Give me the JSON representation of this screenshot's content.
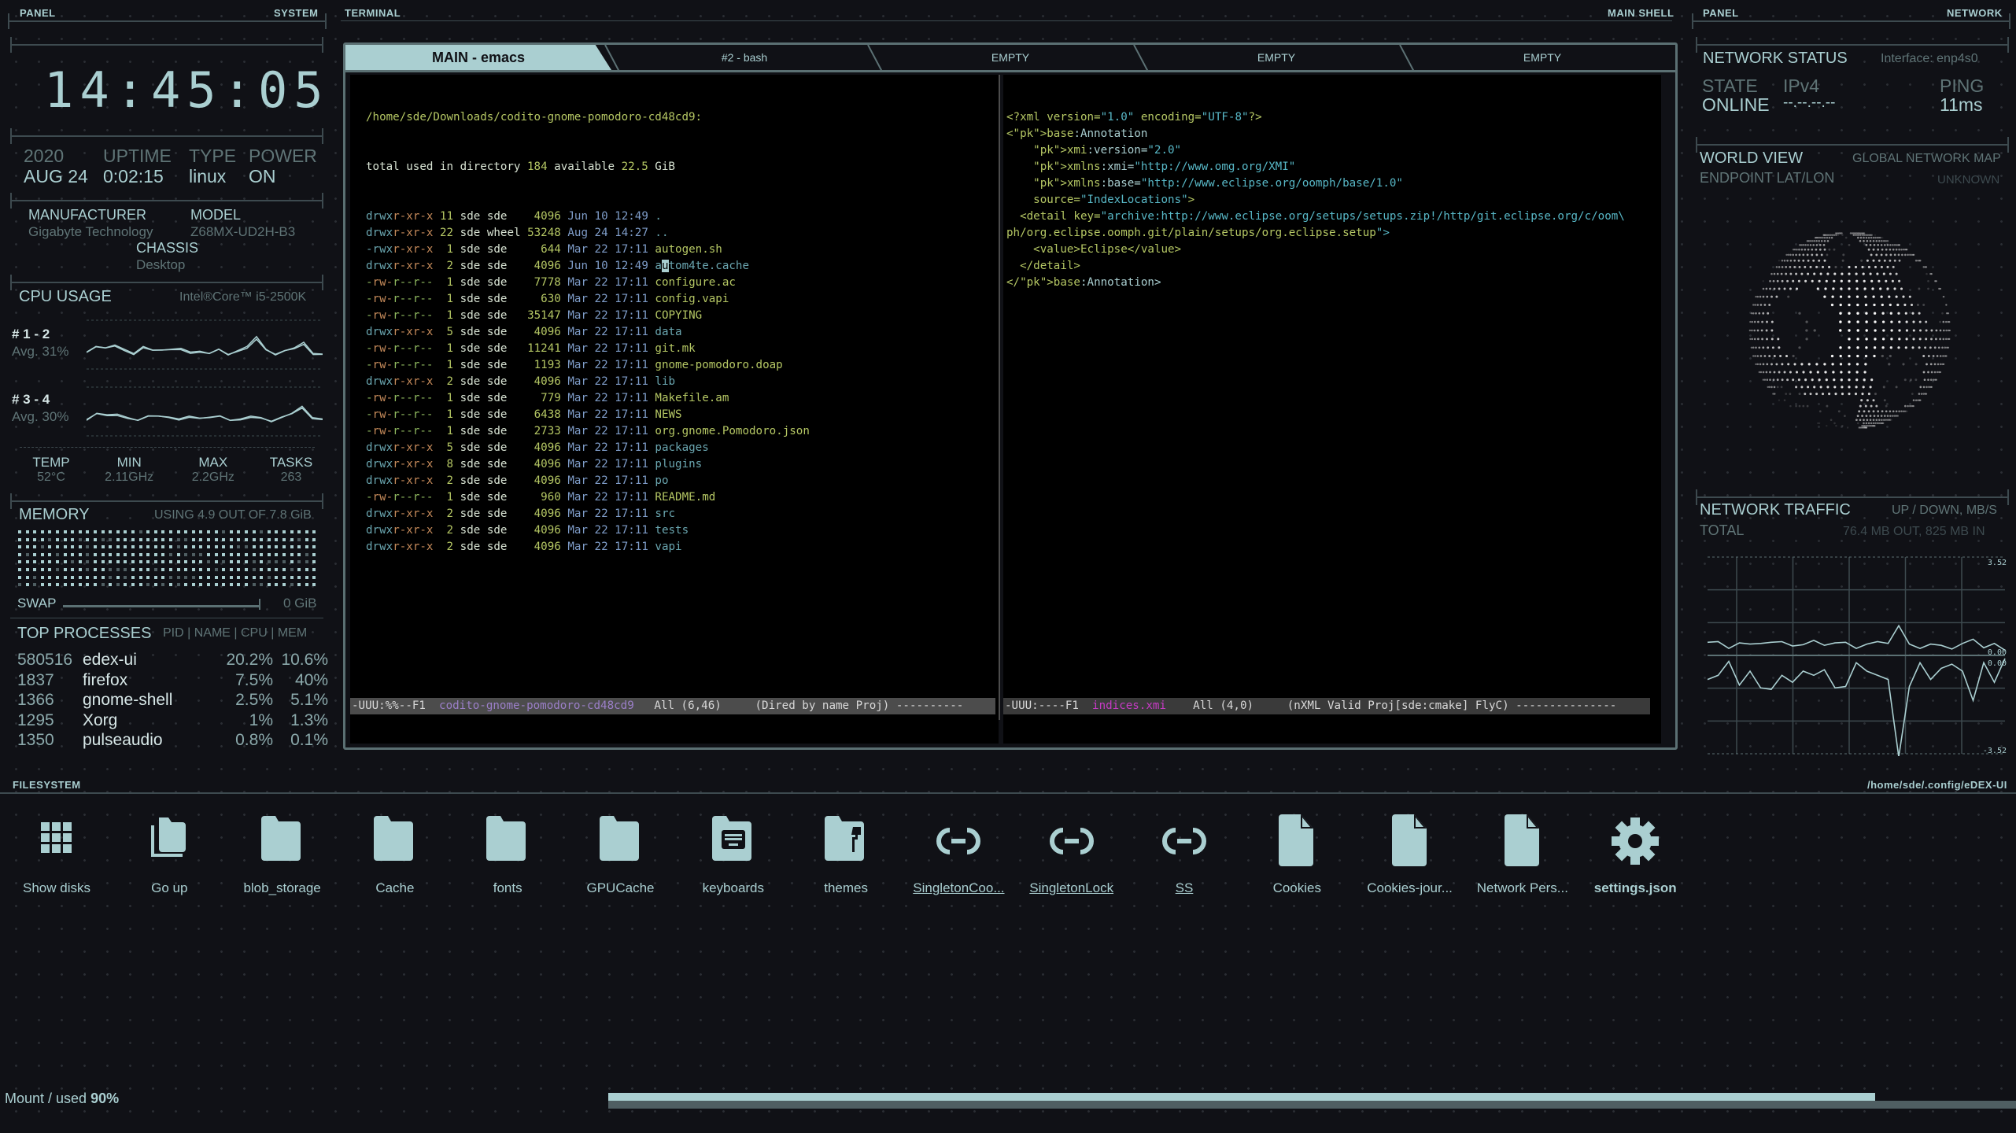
{
  "left_panel": {
    "header_left": "PANEL",
    "header_right": "SYSTEM",
    "clock": "14:45:05",
    "clock_parts": [
      "14",
      "45",
      "05"
    ],
    "date_year": "2020",
    "date_day": "AUG 24",
    "uptime_label": "UPTIME",
    "uptime_value": "0:02:15",
    "type_label": "TYPE",
    "type_value": "linux",
    "power_label": "POWER",
    "power_value": "ON",
    "manufacturer_label": "MANUFACTURER",
    "manufacturer_value": "Gigabyte Technology",
    "model_label": "MODEL",
    "model_value": "Z68MX-UD2H-B3",
    "chassis_label": "CHASSIS",
    "chassis_value": "Desktop",
    "cpu": {
      "title": "CPU USAGE",
      "model": "Intel®Core™ i5-2500K",
      "groups": [
        {
          "label": "# 1 - 2",
          "avg": "Avg. 31%"
        },
        {
          "label": "# 3 - 4",
          "avg": "Avg. 30%"
        }
      ],
      "stats": [
        {
          "label": "TEMP",
          "value": "52°C"
        },
        {
          "label": "MIN",
          "value": "2.11GHz"
        },
        {
          "label": "MAX",
          "value": "2.2GHz"
        },
        {
          "label": "TASKS",
          "value": "263"
        }
      ]
    },
    "memory": {
      "title": "MEMORY",
      "usage": "USING 4.9 OUT OF 7.8 GiB",
      "used_fraction": 0.63,
      "swap_label": "SWAP",
      "swap_value": "0 GiB"
    },
    "processes": {
      "title": "TOP PROCESSES",
      "columns": "PID | NAME | CPU | MEM",
      "rows": [
        {
          "pid": "580516",
          "name": "edex-ui",
          "cpu": "20.2%",
          "mem": "10.6%"
        },
        {
          "pid": "1837",
          "name": "firefox",
          "cpu": "7.5%",
          "mem": "40%"
        },
        {
          "pid": "1366",
          "name": "gnome-shell",
          "cpu": "2.5%",
          "mem": "5.1%"
        },
        {
          "pid": "1295",
          "name": "Xorg",
          "cpu": "1%",
          "mem": "1.3%"
        },
        {
          "pid": "1350",
          "name": "pulseaudio",
          "cpu": "0.8%",
          "mem": "0.1%"
        }
      ]
    }
  },
  "terminal": {
    "header_left": "TERMINAL",
    "header_right": "MAIN SHELL",
    "tabs": [
      {
        "label": "MAIN - emacs",
        "active": true
      },
      {
        "label": "#2 - bash",
        "active": false
      },
      {
        "label": "EMPTY",
        "active": false
      },
      {
        "label": "EMPTY",
        "active": false
      },
      {
        "label": "EMPTY",
        "active": false
      }
    ],
    "dired": {
      "path": "/home/sde/Downloads/codito-gnome-pomodoro-cd48cd9:",
      "summary_pre": "total used in directory ",
      "summary_used": "184",
      "summary_mid": " available ",
      "summary_avail": "22.5",
      "summary_post": " GiB",
      "entries": [
        {
          "perm": "drwxr-xr-x",
          "links": "11",
          "user": "sde",
          "group": "sde  ",
          "size": " 4096",
          "date": "Jun 10 12:49",
          "name": ".",
          "dir": true
        },
        {
          "perm": "drwxr-xr-x",
          "links": "22",
          "user": "sde",
          "group": "wheel",
          "size": "53248",
          "date": "Aug 24 14:27",
          "name": "..",
          "dir": true
        },
        {
          "perm": "-rwxr-xr-x",
          "links": " 1",
          "user": "sde",
          "group": "sde  ",
          "size": "  644",
          "date": "Mar 22 17:11",
          "name": "autogen.sh",
          "dir": false
        },
        {
          "perm": "drwxr-xr-x",
          "links": " 2",
          "user": "sde",
          "group": "sde  ",
          "size": " 4096",
          "date": "Jun 10 12:49",
          "name": "autom4te.cache",
          "dir": true
        },
        {
          "perm": "-rw-r--r--",
          "links": " 1",
          "user": "sde",
          "group": "sde  ",
          "size": " 7778",
          "date": "Mar 22 17:11",
          "name": "configure.ac",
          "dir": false
        },
        {
          "perm": "-rw-r--r--",
          "links": " 1",
          "user": "sde",
          "group": "sde  ",
          "size": "  630",
          "date": "Mar 22 17:11",
          "name": "config.vapi",
          "dir": false
        },
        {
          "perm": "-rw-r--r--",
          "links": " 1",
          "user": "sde",
          "group": "sde  ",
          "size": "35147",
          "date": "Mar 22 17:11",
          "name": "COPYING",
          "dir": false
        },
        {
          "perm": "drwxr-xr-x",
          "links": " 5",
          "user": "sde",
          "group": "sde  ",
          "size": " 4096",
          "date": "Mar 22 17:11",
          "name": "data",
          "dir": true
        },
        {
          "perm": "-rw-r--r--",
          "links": " 1",
          "user": "sde",
          "group": "sde  ",
          "size": "11241",
          "date": "Mar 22 17:11",
          "name": "git.mk",
          "dir": false
        },
        {
          "perm": "-rw-r--r--",
          "links": " 1",
          "user": "sde",
          "group": "sde  ",
          "size": " 1193",
          "date": "Mar 22 17:11",
          "name": "gnome-pomodoro.doap",
          "dir": false
        },
        {
          "perm": "drwxr-xr-x",
          "links": " 2",
          "user": "sde",
          "group": "sde  ",
          "size": " 4096",
          "date": "Mar 22 17:11",
          "name": "lib",
          "dir": true
        },
        {
          "perm": "-rw-r--r--",
          "links": " 1",
          "user": "sde",
          "group": "sde  ",
          "size": "  779",
          "date": "Mar 22 17:11",
          "name": "Makefile.am",
          "dir": false
        },
        {
          "perm": "-rw-r--r--",
          "links": " 1",
          "user": "sde",
          "group": "sde  ",
          "size": " 6438",
          "date": "Mar 22 17:11",
          "name": "NEWS",
          "dir": false
        },
        {
          "perm": "-rw-r--r--",
          "links": " 1",
          "user": "sde",
          "group": "sde  ",
          "size": " 2733",
          "date": "Mar 22 17:11",
          "name": "org.gnome.Pomodoro.json",
          "dir": false
        },
        {
          "perm": "drwxr-xr-x",
          "links": " 5",
          "user": "sde",
          "group": "sde  ",
          "size": " 4096",
          "date": "Mar 22 17:11",
          "name": "packages",
          "dir": true
        },
        {
          "perm": "drwxr-xr-x",
          "links": " 8",
          "user": "sde",
          "group": "sde  ",
          "size": " 4096",
          "date": "Mar 22 17:11",
          "name": "plugins",
          "dir": true
        },
        {
          "perm": "drwxr-xr-x",
          "links": " 2",
          "user": "sde",
          "group": "sde  ",
          "size": " 4096",
          "date": "Mar 22 17:11",
          "name": "po",
          "dir": true
        },
        {
          "perm": "-rw-r--r--",
          "links": " 1",
          "user": "sde",
          "group": "sde  ",
          "size": "  960",
          "date": "Mar 22 17:11",
          "name": "README.md",
          "dir": false
        },
        {
          "perm": "drwxr-xr-x",
          "links": " 2",
          "user": "sde",
          "group": "sde  ",
          "size": " 4096",
          "date": "Mar 22 17:11",
          "name": "src",
          "dir": true
        },
        {
          "perm": "drwxr-xr-x",
          "links": " 2",
          "user": "sde",
          "group": "sde  ",
          "size": " 4096",
          "date": "Mar 22 17:11",
          "name": "tests",
          "dir": true
        },
        {
          "perm": "drwxr-xr-x",
          "links": " 2",
          "user": "sde",
          "group": "sde  ",
          "size": " 4096",
          "date": "Mar 22 17:11",
          "name": "vapi",
          "dir": true
        }
      ],
      "modeline": {
        "status": "-UUU:%%--F1  ",
        "buffer": "codito-gnome-pomodoro-cd48cd9",
        "position": "   All (6,46)     ",
        "mode": "(Dired by name Proj) ----------"
      }
    },
    "xml": {
      "lines": [
        "<?xml version=\"1.0\" encoding=\"UTF-8\"?>",
        "<base:Annotation",
        "    xmi:version=\"2.0\"",
        "    xmlns:xmi=\"http://www.omg.org/XMI\"",
        "    xmlns:base=\"http://www.eclipse.org/oomph/base/1.0\"",
        "    source=\"IndexLocations\">",
        "  <detail key=\"archive:http://www.eclipse.org/setups/setups.zip!/http/git.eclipse.org/c/oom\\",
        "ph/org.eclipse.oomph.git/plain/setups/org.eclipse.setup\">",
        "    <value>Eclipse</value>",
        "  </detail>",
        "</base:Annotation>"
      ],
      "modeline": {
        "status": "-UUU:----F1  ",
        "buffer": "indices.xmi",
        "position": "    All (4,0)     ",
        "mode": "(nXML Valid Proj[sde:cmake] FlyC) ---------------"
      }
    }
  },
  "right_panel": {
    "header_left": "PANEL",
    "header_right": "NETWORK",
    "status": {
      "title": "NETWORK STATUS",
      "interface": "Interface: enp4s0",
      "state_label": "STATE",
      "state_value": "ONLINE",
      "ipv4_label": "IPv4",
      "ipv4_value": "--.--.--.--",
      "ping_label": "PING",
      "ping_value": "11ms"
    },
    "world": {
      "title": "WORLD VIEW",
      "subtitle": "GLOBAL NETWORK MAP",
      "endpoint_label": "ENDPOINT LAT/LON",
      "endpoint_value": "UNKNOWN"
    },
    "traffic": {
      "title": "NETWORK TRAFFIC",
      "units": "UP / DOWN, MB/S",
      "total_label": "TOTAL",
      "total_value": "76.4 MB OUT, 825 MB IN",
      "max_label": "3.52",
      "zero_up_label": "0.00",
      "zero_down_label": "0.00",
      "min_label": "-3.52"
    }
  },
  "chart_data": {
    "type": "line",
    "title": "NETWORK TRAFFIC",
    "ylabel": "MB/S",
    "ylim": [
      -3.52,
      3.52
    ],
    "series": [
      {
        "name": "up",
        "values": [
          0.15,
          0.16,
          0.05,
          0.14,
          0.12,
          0.13,
          0.15,
          0.16,
          0.09,
          0.11,
          0.18,
          0.1,
          0.14,
          0.15,
          0.05,
          0.12,
          0.16,
          0.13,
          0.42,
          0.12,
          0.05,
          0.12,
          0.1,
          0.04,
          0.13,
          0.2,
          0.06,
          0.13,
          0.02
        ]
      },
      {
        "name": "down",
        "values": [
          -0.75,
          -0.6,
          -0.1,
          -0.95,
          -0.45,
          -1.05,
          -1.1,
          -0.6,
          -0.85,
          -0.45,
          -0.6,
          -0.4,
          -1.05,
          -1.0,
          -0.15,
          -0.45,
          -0.6,
          -0.75,
          -3.52,
          -1.0,
          -0.15,
          -0.75,
          -0.35,
          -0.2,
          -0.45,
          -1.5,
          -0.15,
          -0.85,
          0.0
        ]
      }
    ]
  },
  "cpu_charts": {
    "core12": [
      0.35,
      0.55,
      0.5,
      0.6,
      0.45,
      0.3,
      0.55,
      0.42,
      0.42,
      0.45,
      0.48,
      0.35,
      0.38,
      0.3,
      0.45,
      0.25,
      0.4,
      0.55,
      0.9,
      0.45,
      0.25,
      0.4,
      0.5,
      0.7,
      0.3,
      0.28
    ],
    "core34": [
      0.3,
      0.55,
      0.5,
      0.52,
      0.4,
      0.3,
      0.45,
      0.45,
      0.42,
      0.35,
      0.45,
      0.38,
      0.4,
      0.45,
      0.3,
      0.35,
      0.45,
      0.4,
      0.25,
      0.4,
      0.55,
      0.8,
      0.4,
      0.35
    ]
  },
  "filesystem": {
    "header_left": "FILESYSTEM",
    "header_right": "/home/sde/.config/eDEX-UI",
    "items": [
      {
        "label": "Show disks",
        "icon": "grid-icon",
        "style": "normal"
      },
      {
        "label": "Go up",
        "icon": "folder-up-icon",
        "style": "normal"
      },
      {
        "label": "blob_storage",
        "icon": "folder-icon",
        "style": "normal"
      },
      {
        "label": "Cache",
        "icon": "folder-icon",
        "style": "normal"
      },
      {
        "label": "fonts",
        "icon": "folder-icon",
        "style": "normal"
      },
      {
        "label": "GPUCache",
        "icon": "folder-icon",
        "style": "normal"
      },
      {
        "label": "keyboards",
        "icon": "keyboard-folder-icon",
        "style": "normal"
      },
      {
        "label": "themes",
        "icon": "themes-folder-icon",
        "style": "normal"
      },
      {
        "label": "SingletonCoo...",
        "icon": "symlink-icon",
        "style": "link"
      },
      {
        "label": "SingletonLock",
        "icon": "symlink-icon",
        "style": "link"
      },
      {
        "label": "SS",
        "icon": "symlink-icon",
        "style": "link"
      },
      {
        "label": "Cookies",
        "icon": "file-icon",
        "style": "normal"
      },
      {
        "label": "Cookies-jour...",
        "icon": "file-icon",
        "style": "normal"
      },
      {
        "label": "Network Pers...",
        "icon": "file-icon",
        "style": "normal"
      },
      {
        "label": "settings.json",
        "icon": "gear-icon",
        "style": "bold"
      }
    ],
    "mount_label": "Mount / used ",
    "mount_percent": "90%",
    "mount_used_fraction": 0.9
  }
}
